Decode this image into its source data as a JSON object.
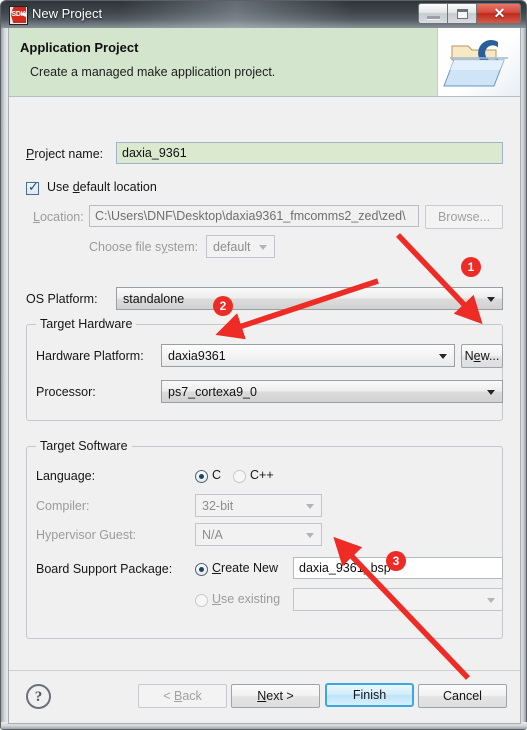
{
  "window": {
    "title": "New Project",
    "icon": "sdk-icon",
    "icon_label": "SDK",
    "buttons": {
      "minimize": "minimize-icon",
      "maximize": "maximize-icon",
      "close": "✕"
    }
  },
  "banner": {
    "title": "Application Project",
    "description": "Create a managed make application project.",
    "icon": "c-project-folder-icon",
    "icon_letter": "C",
    "background_color": "#d4e5ce"
  },
  "form": {
    "project_name": {
      "label": "Project name:",
      "label_mnemonic": "P",
      "value": "daxia_9361",
      "field_color": "#dbeacf"
    },
    "use_default_location": {
      "label": "Use default location",
      "checked": true
    },
    "location": {
      "label": "Location:",
      "value": "C:\\Users\\DNF\\Desktop\\daxia9361_fmcomms2_zed\\zed\\",
      "disabled": true,
      "browse_label": "Browse..."
    },
    "choose_file_system": {
      "label": "Choose file system:",
      "value": "default",
      "disabled": true
    },
    "os_platform": {
      "label": "OS Platform:",
      "value": "standalone"
    },
    "target_hardware": {
      "group_title": "Target Hardware",
      "hardware_platform": {
        "label": "Hardware Platform:",
        "value": "daxia9361"
      },
      "new_button": "New...",
      "processor": {
        "label": "Processor:",
        "value": "ps7_cortexa9_0"
      }
    },
    "target_software": {
      "group_title": "Target Software",
      "language": {
        "label": "Language:",
        "options": [
          {
            "label": "C",
            "selected": true
          },
          {
            "label": "C++",
            "selected": false
          }
        ]
      },
      "compiler": {
        "label": "Compiler:",
        "value": "32-bit",
        "disabled": true
      },
      "hypervisor_guest": {
        "label": "Hypervisor Guest:",
        "value": "N/A",
        "disabled": true
      },
      "board_support_package": {
        "label": "Board Support Package:",
        "create_new": {
          "label": "Create New",
          "selected": true,
          "value": "daxia_9361_bsp"
        },
        "use_existing": {
          "label": "Use existing",
          "selected": false,
          "value": "",
          "disabled": true
        }
      }
    }
  },
  "footer": {
    "help": "?",
    "back": "< Back",
    "next": "Next >",
    "finish": "Finish",
    "cancel": "Cancel"
  },
  "annotations": {
    "accent_color": "#ee2b24",
    "badges": [
      {
        "label": "1",
        "target": "new-button"
      },
      {
        "label": "2",
        "target": "hardware-platform-combo"
      },
      {
        "label": "3",
        "target": "bsp-create-new-input"
      }
    ]
  }
}
